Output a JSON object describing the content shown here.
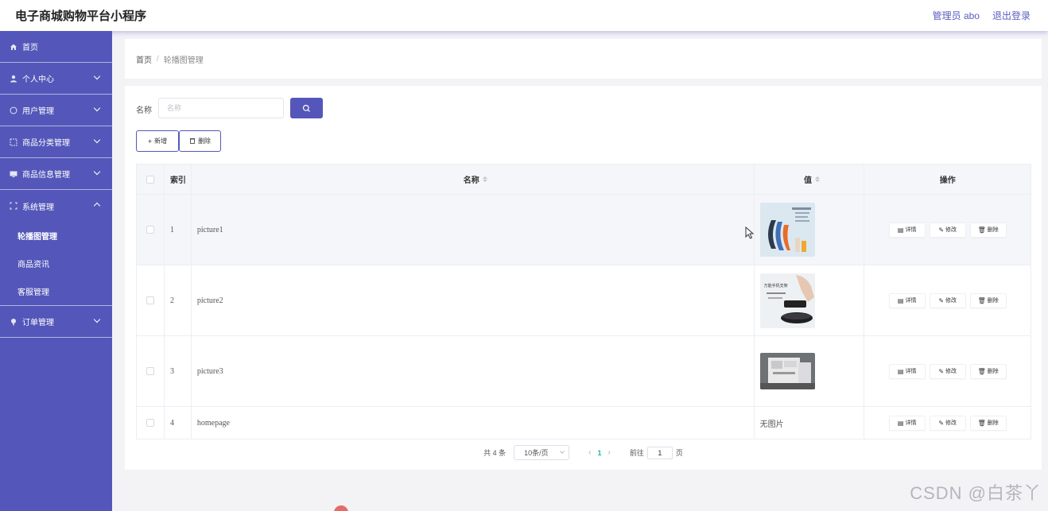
{
  "header": {
    "app_title": "电子商城购物平台小程序",
    "admin_label": "管理员 abo",
    "logout_label": "退出登录"
  },
  "sidebar": {
    "items": [
      {
        "label": "首页",
        "icon": "home-icon"
      },
      {
        "label": "个人中心",
        "icon": "user-icon"
      },
      {
        "label": "用户管理",
        "icon": "users-icon"
      },
      {
        "label": "商品分类管理",
        "icon": "category-icon"
      },
      {
        "label": "商品信息管理",
        "icon": "monitor-icon"
      },
      {
        "label": "系统管理",
        "icon": "system-icon"
      },
      {
        "label": "订单管理",
        "icon": "order-icon"
      }
    ],
    "system_sub": [
      "轮播图管理",
      "商品资讯",
      "客服管理"
    ]
  },
  "breadcrumb": {
    "home": "首页",
    "separator": "/",
    "current": "轮播图管理"
  },
  "search": {
    "label": "名称",
    "placeholder": "名称"
  },
  "toolbar": {
    "add_label": "新增",
    "delete_label": "删除"
  },
  "table": {
    "headers": {
      "index": "索引",
      "name": "名称",
      "value": "值",
      "ops": "操作"
    },
    "ops": {
      "detail": "详情",
      "edit": "修改",
      "delete": "删除"
    },
    "rows": [
      {
        "index": "1",
        "name": "picture1"
      },
      {
        "index": "2",
        "name": "picture2"
      },
      {
        "index": "3",
        "name": "picture3"
      },
      {
        "index": "4",
        "name": "homepage",
        "value_text": "无图片"
      }
    ]
  },
  "pagination": {
    "total": "共 4 条",
    "page_size": "10条/页",
    "current_page": "1",
    "goto_label": "前往",
    "goto_value": "1",
    "page_unit": "页"
  },
  "thumb_text": {
    "picture2": "万能手机支架"
  },
  "watermark": "CSDN @白茶丫",
  "colors": {
    "primary": "#5457b9",
    "active_page": "#2bb0a4"
  }
}
